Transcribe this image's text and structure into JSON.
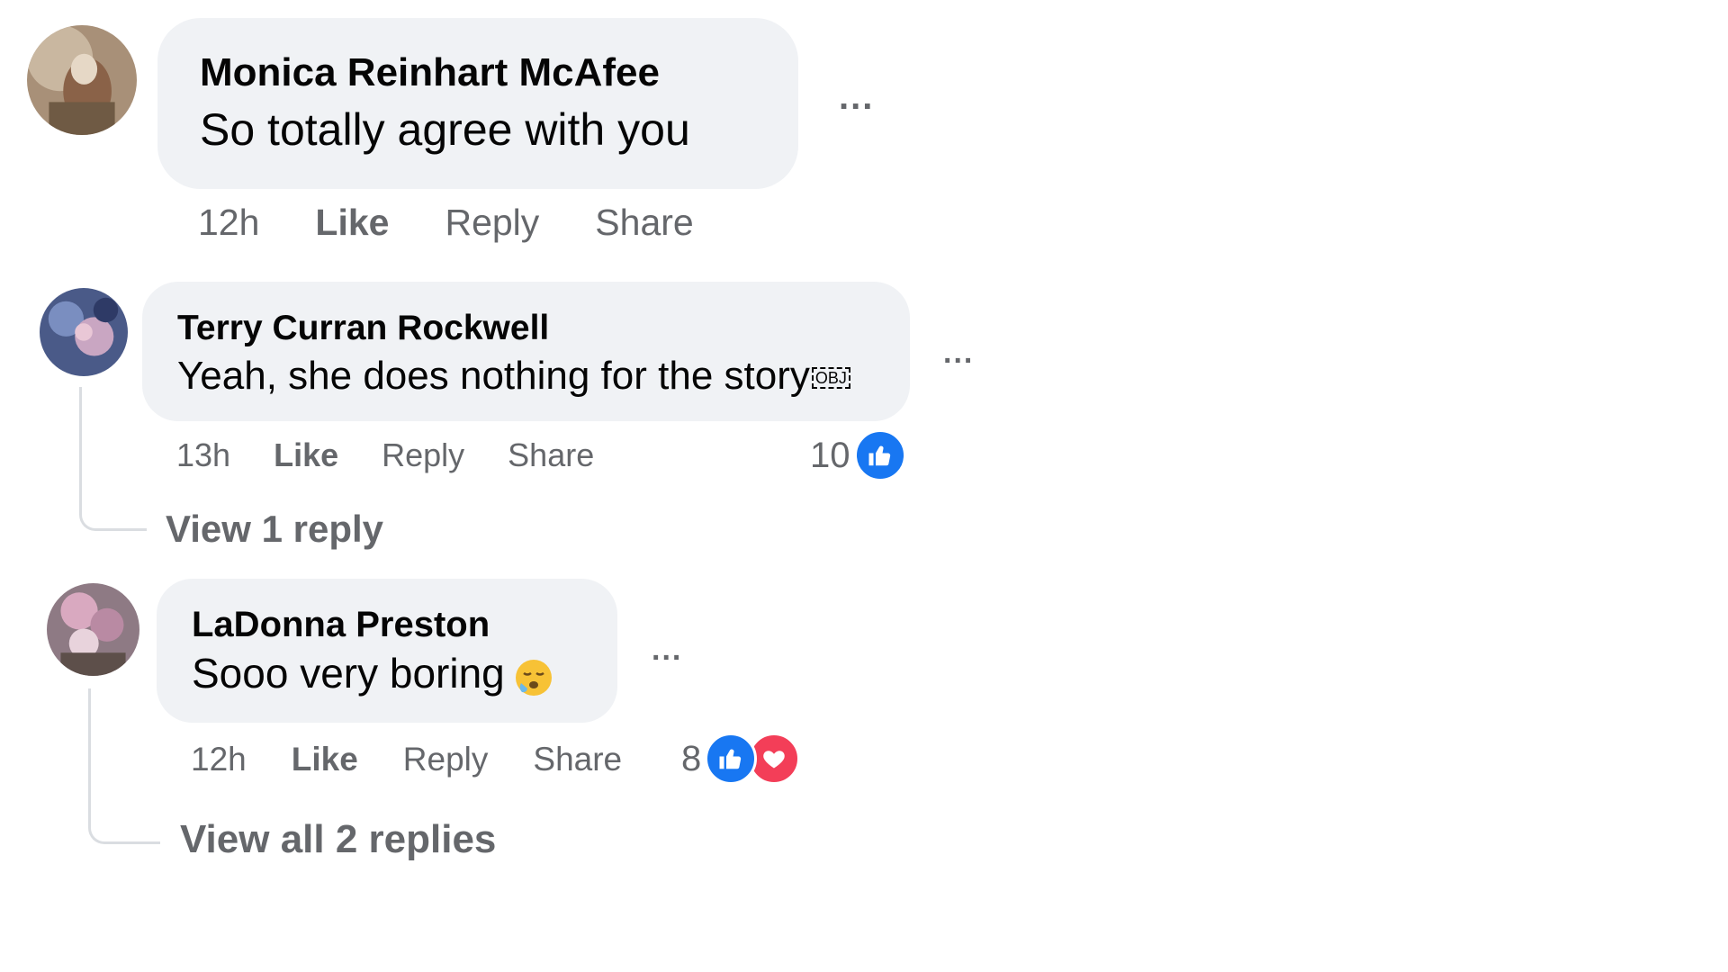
{
  "comments": [
    {
      "author": "Monica Reinhart McAfee",
      "text": "So totally agree with you",
      "more_label": "...",
      "time": "12h",
      "like_label": "Like",
      "reply_label": "Reply",
      "share_label": "Share"
    },
    {
      "author": "Terry Curran Rockwell",
      "text": "Yeah, she does nothing for the story",
      "text_object": "OBJ",
      "more_label": "...",
      "time": "13h",
      "like_label": "Like",
      "reply_label": "Reply",
      "share_label": "Share",
      "reaction_count": "10",
      "reactions": [
        "like"
      ],
      "view_replies_label": "View 1 reply"
    },
    {
      "author": "LaDonna Preston",
      "text": "Sooo very boring",
      "emoji": "sleepy-face",
      "more_label": "...",
      "time": "12h",
      "like_label": "Like",
      "reply_label": "Reply",
      "share_label": "Share",
      "reaction_count": "8",
      "reactions": [
        "like",
        "love"
      ],
      "view_replies_label": "View all 2 replies"
    }
  ],
  "colors": {
    "bubble": "#f0f2f5",
    "muted_text": "#65676b",
    "like_blue": "#1877f2",
    "love_red": "#f33e58"
  }
}
